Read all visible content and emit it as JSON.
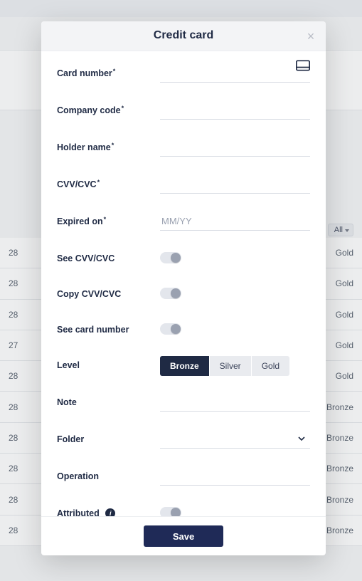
{
  "modal": {
    "title": "Credit card",
    "labels": {
      "card_number": "Card number",
      "company_code": "Company code",
      "holder_name": "Holder name",
      "cvv": "CVV/CVC",
      "expired_on": "Expired on",
      "see_cvv": "See CVV/CVC",
      "copy_cvv": "Copy CVV/CVC",
      "see_card_number": "See card number",
      "level": "Level",
      "note": "Note",
      "folder": "Folder",
      "operation": "Operation",
      "attributed": "Attributed"
    },
    "placeholders": {
      "expired_on": "MM/YY"
    },
    "levels": [
      "Bronze",
      "Silver",
      "Gold"
    ],
    "level_selected": "Bronze",
    "toggles": {
      "see_cvv": false,
      "copy_cvv": false,
      "see_card_number": false,
      "attributed": false
    },
    "save_label": "Save"
  },
  "background": {
    "filter_all": "All",
    "rows": [
      {
        "left": "28",
        "right": "Gold"
      },
      {
        "left": "28",
        "right": "Gold"
      },
      {
        "left": "28",
        "right": "Gold"
      },
      {
        "left": "27",
        "right": "Gold"
      },
      {
        "left": "28",
        "right": "Gold"
      },
      {
        "left": "28",
        "right": "Bronze"
      },
      {
        "left": "28",
        "right": "Bronze"
      },
      {
        "left": "28",
        "right": "Bronze"
      },
      {
        "left": "28",
        "right": "Bronze"
      },
      {
        "left": "28",
        "right": "Bronze"
      }
    ]
  }
}
